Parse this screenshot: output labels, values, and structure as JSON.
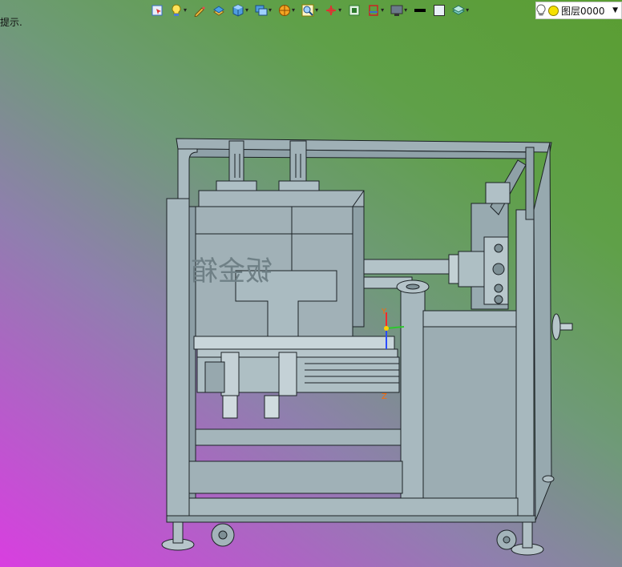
{
  "status": {
    "hint": "提示."
  },
  "toolbar": {
    "items": [
      {
        "icon": "cursor-select-icon",
        "dropdown": false
      },
      {
        "icon": "light-bulb-icon",
        "dropdown": true
      },
      {
        "icon": "pencil-sketch-icon",
        "dropdown": false
      },
      {
        "icon": "extrude-icon",
        "dropdown": false
      },
      {
        "icon": "cube-icon",
        "dropdown": true
      },
      {
        "icon": "display-style-icon",
        "dropdown": true
      },
      {
        "icon": "render-ball-icon",
        "dropdown": true
      },
      {
        "icon": "zoom-icon",
        "dropdown": true
      },
      {
        "icon": "axis-icon",
        "dropdown": true
      },
      {
        "icon": "view-fit-icon",
        "dropdown": false
      },
      {
        "icon": "section-view-icon",
        "dropdown": true
      },
      {
        "icon": "monitor-icon",
        "dropdown": true
      },
      {
        "icon": "line-width-icon",
        "dropdown": false
      },
      {
        "icon": "color-box-icon",
        "dropdown": false
      },
      {
        "icon": "layer-plane-icon",
        "dropdown": true
      }
    ]
  },
  "layer": {
    "label": "图层0000",
    "bulb_color": "#f6e000"
  },
  "model": {
    "engraved_text": "钣金箱",
    "body_color": "#9fb0b6",
    "edge_color": "#1c2226",
    "accent_colors": {
      "x_axis": "#ff2a2a",
      "y_axis": "#2dc82d",
      "z_axis": "#2a4cff"
    }
  }
}
